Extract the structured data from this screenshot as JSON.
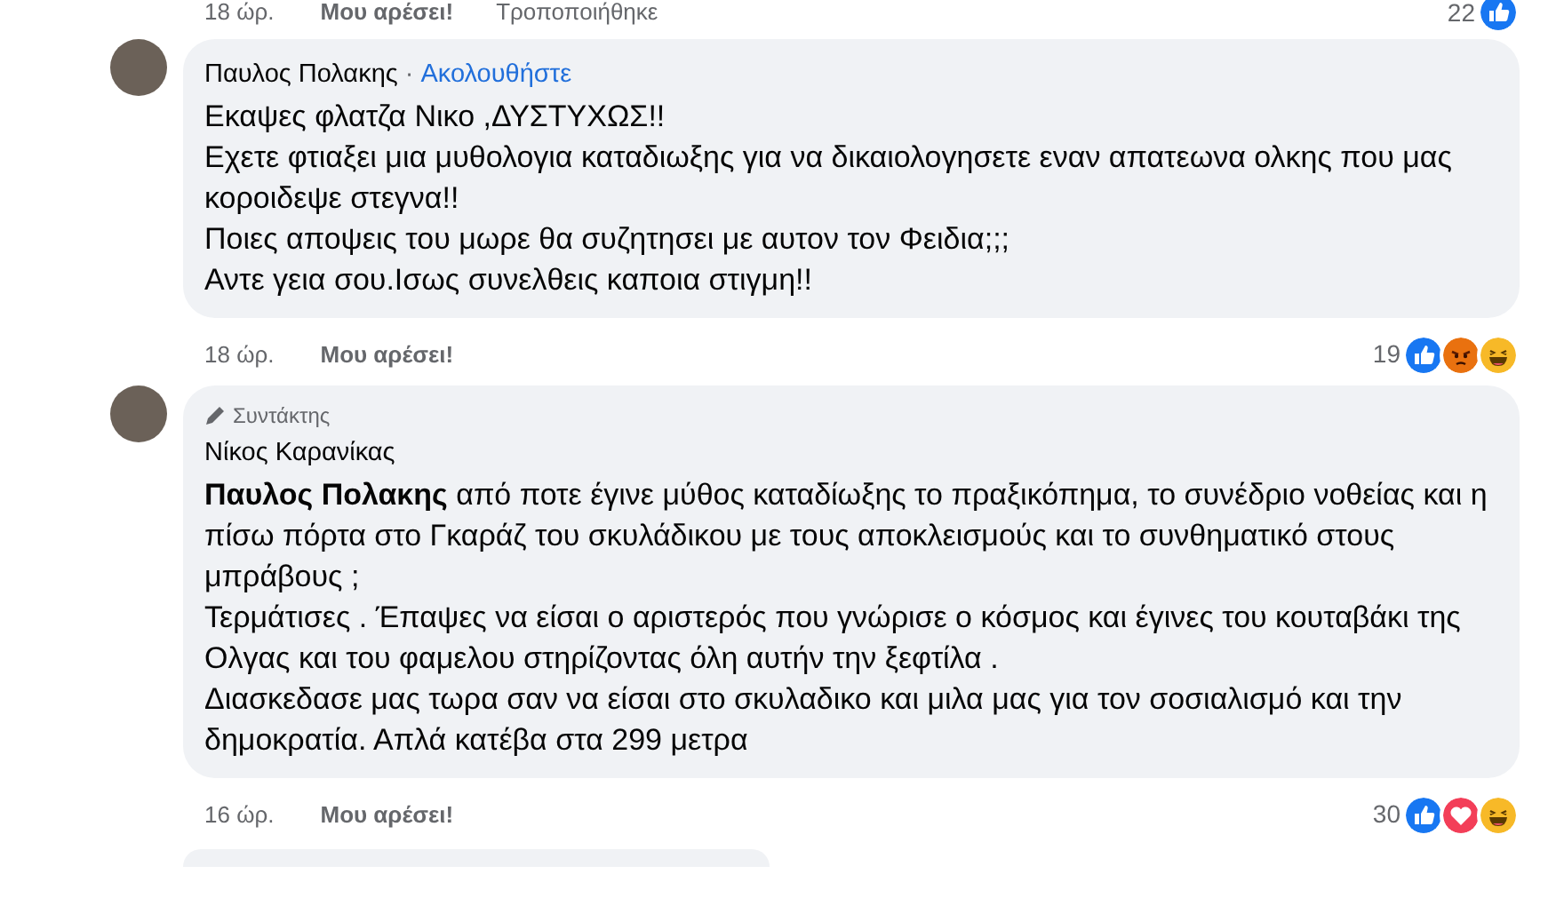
{
  "top_action_row": {
    "time": "18 ώρ.",
    "like": "Μου αρέσει!",
    "edited": "Τροποποιήθηκε",
    "reaction_count": "22",
    "reactions": [
      {
        "kind": "like"
      }
    ]
  },
  "comments": [
    {
      "author": "Παυλος Πολακης",
      "separator": "·",
      "follow": "Ακολουθήστε",
      "lines": [
        "Εκαψες φλατζα Νικο ,ΔΥΣΤΥΧΩΣ!!",
        "Εχετε φτιαξει μια μυθολογια καταδιωξης για να δικαιολογησετε εναν απατεωνα ολκης που μας κοροιδεψε στεγνα!!",
        "Ποιες αποψεις του μωρε θα συζητησει με αυτον τον Φειδια;;;",
        "Αντε γεια σου.Ισως συνελθεις καποια στιγμη!!"
      ],
      "time": "18 ώρ.",
      "like": "Μου αρέσει!",
      "reaction_count": "19",
      "reactions": [
        {
          "kind": "like"
        },
        {
          "kind": "angry"
        },
        {
          "kind": "haha"
        }
      ]
    },
    {
      "badge": "Συντάκτης",
      "author": "Νίκος Καρανίκας",
      "lines": [
        "**Παυλος Πολακης** από ποτε έγινε μύθος καταδίωξης το πραξικόπημα, το συνέδριο νοθείας και η πίσω πόρτα στο Γκαράζ του σκυλάδικου με τους αποκλεισμούς και το συνθηματικό στους μπράβους ;",
        "Τερμάτισες . Έπαψες να είσαι ο αριστερός που γνώρισε ο κόσμος και έγινες του κουταβάκι της Ολγας και του φαμελου στηρίζοντας όλη αυτήν την ξεφτίλα .",
        "Διασκεδασε μας τωρα σαν να είσαι στο σκυλαδικο και μιλα μας για τον σοσιαλισμό και την δημοκρατία. Απλά κατέβα στα 299 μετρα"
      ],
      "time": "16 ώρ.",
      "like": "Μου αρέσει!",
      "reaction_count": "30",
      "reactions": [
        {
          "kind": "like"
        },
        {
          "kind": "love"
        },
        {
          "kind": "haha"
        }
      ]
    }
  ]
}
